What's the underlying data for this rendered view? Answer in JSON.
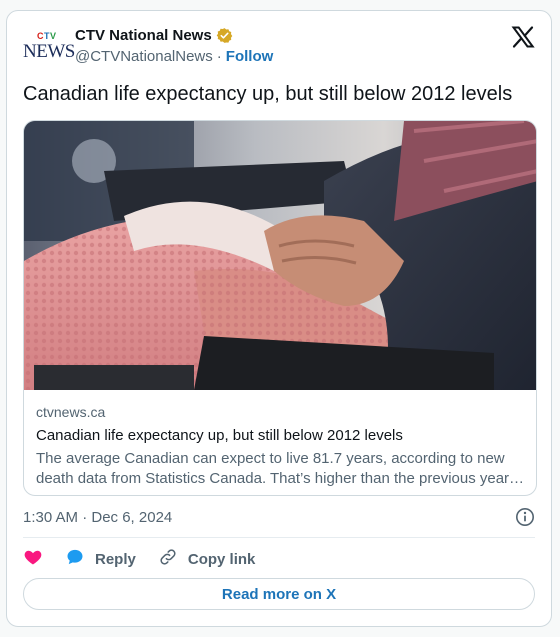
{
  "account": {
    "logo_ctv": "CTV",
    "logo_news": "NEWS",
    "name": "CTV National News",
    "handle": "@CTVNationalNews",
    "separator": "·",
    "follow_label": "Follow"
  },
  "tweet": {
    "text": "Canadian life expectancy up, but still below 2012 levels"
  },
  "link_card": {
    "domain": "ctvnews.ca",
    "title": "Canadian life expectancy up, but still below 2012 levels",
    "description_line1": "The average Canadian can expect to live 81.7 years, according to new",
    "description_line2": "death data from Statistics Canada. That’s higher than the previous year…"
  },
  "meta": {
    "timestamp": "1:30 AM · Dec 6, 2024"
  },
  "actions": {
    "reply_label": "Reply",
    "copy_link_label": "Copy link",
    "read_more_label": "Read more on X"
  },
  "icons": {
    "verified": "verified-gold-badge-icon",
    "x_logo": "x-logo-icon",
    "info": "info-icon",
    "like": "heart-icon",
    "reply": "speech-bubble-icon",
    "copy_link": "link-icon"
  },
  "colors": {
    "link_blue": "#1d74b8",
    "like_pink": "#f91880",
    "reply_blue": "#1d9bf0",
    "secondary_text": "#536471",
    "border": "#cfd9de"
  }
}
